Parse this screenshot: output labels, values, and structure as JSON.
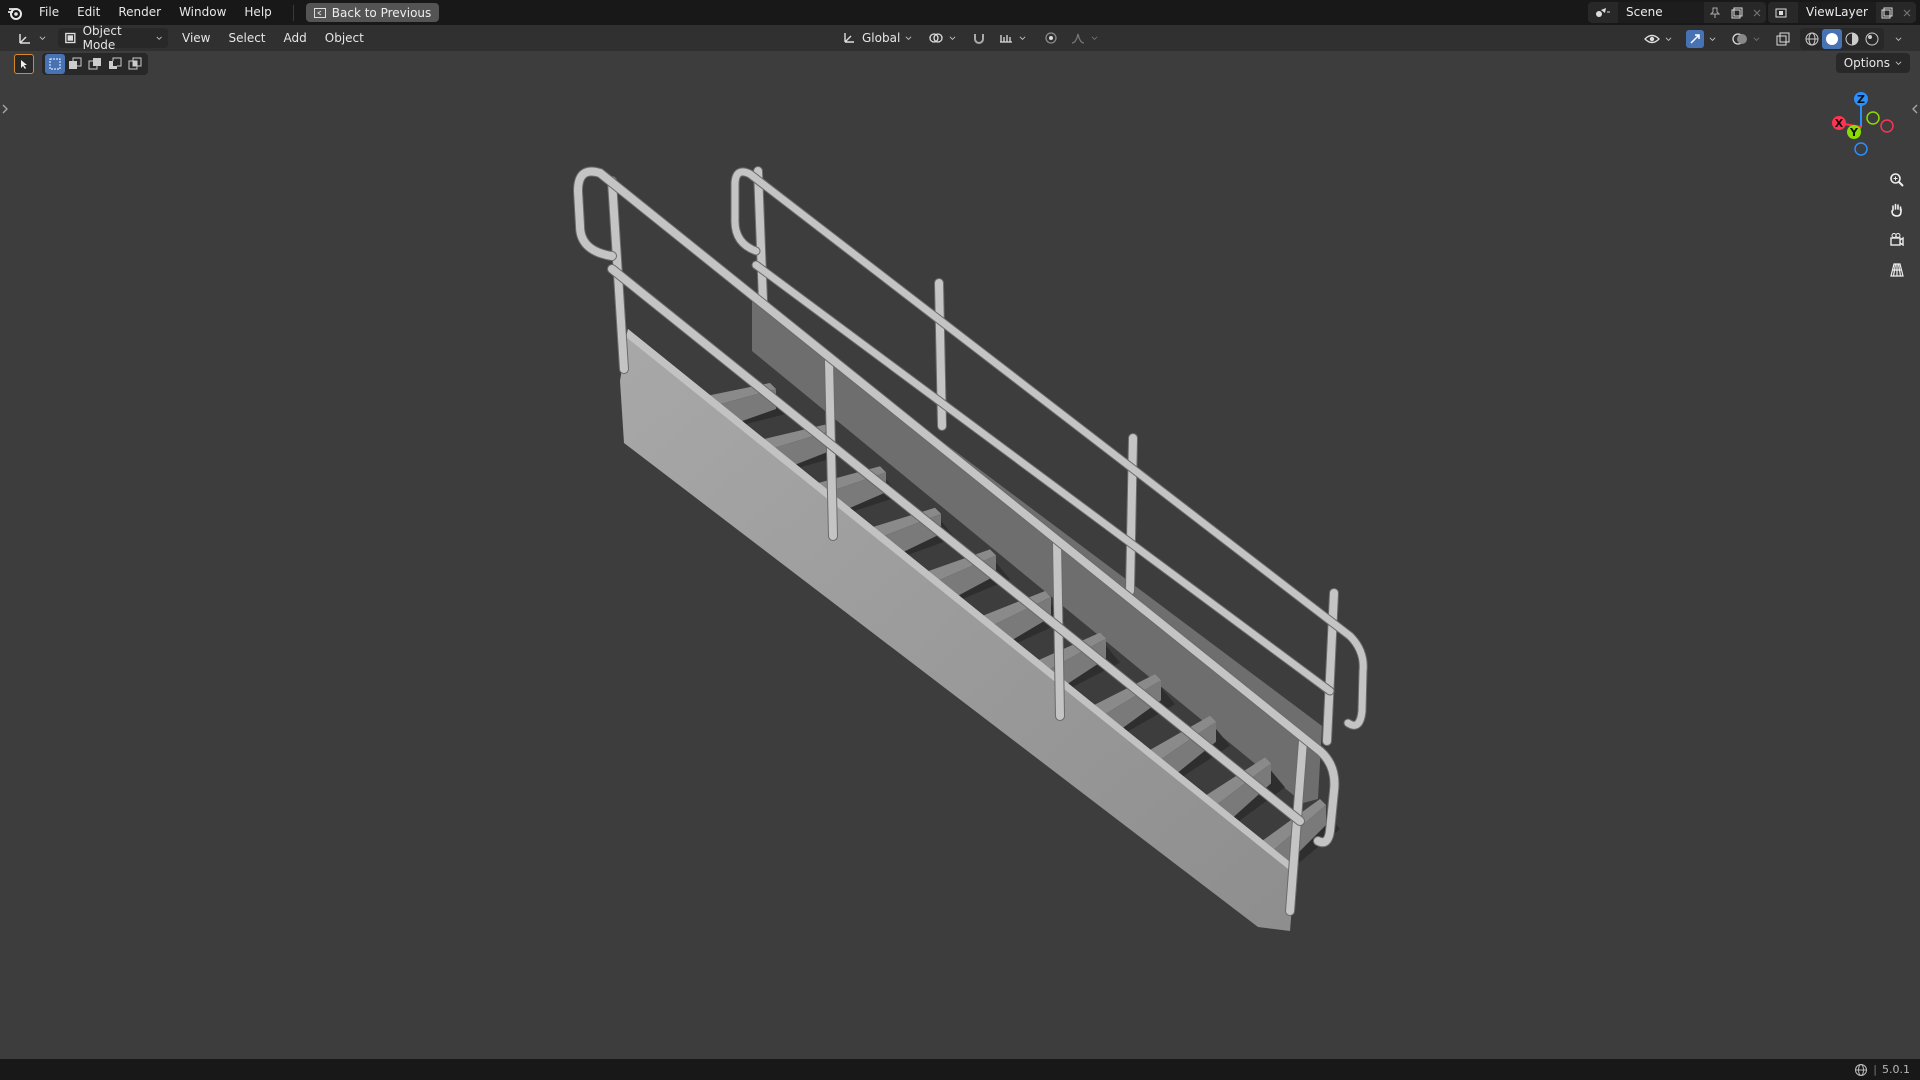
{
  "topbar": {
    "menu": [
      "File",
      "Edit",
      "Render",
      "Window",
      "Help"
    ],
    "back_button": "Back to Previous",
    "scene_label": "Scene",
    "view_layer_label": "ViewLayer"
  },
  "header": {
    "mode": "Object Mode",
    "menus": [
      "View",
      "Select",
      "Add",
      "Object"
    ],
    "transform_orientation": "Global"
  },
  "toolrow": {
    "options_label": "Options"
  },
  "gizmo": {
    "x_label": "X",
    "y_label": "Y",
    "z_label": "Z"
  },
  "statusbar": {
    "version": "5.0.1"
  },
  "colors": {
    "accent": "#4772b3",
    "axis_x": "#ff3352",
    "axis_y": "#8bdc00",
    "axis_z": "#2890ff",
    "viewport_bg": "#3d3d3d"
  }
}
